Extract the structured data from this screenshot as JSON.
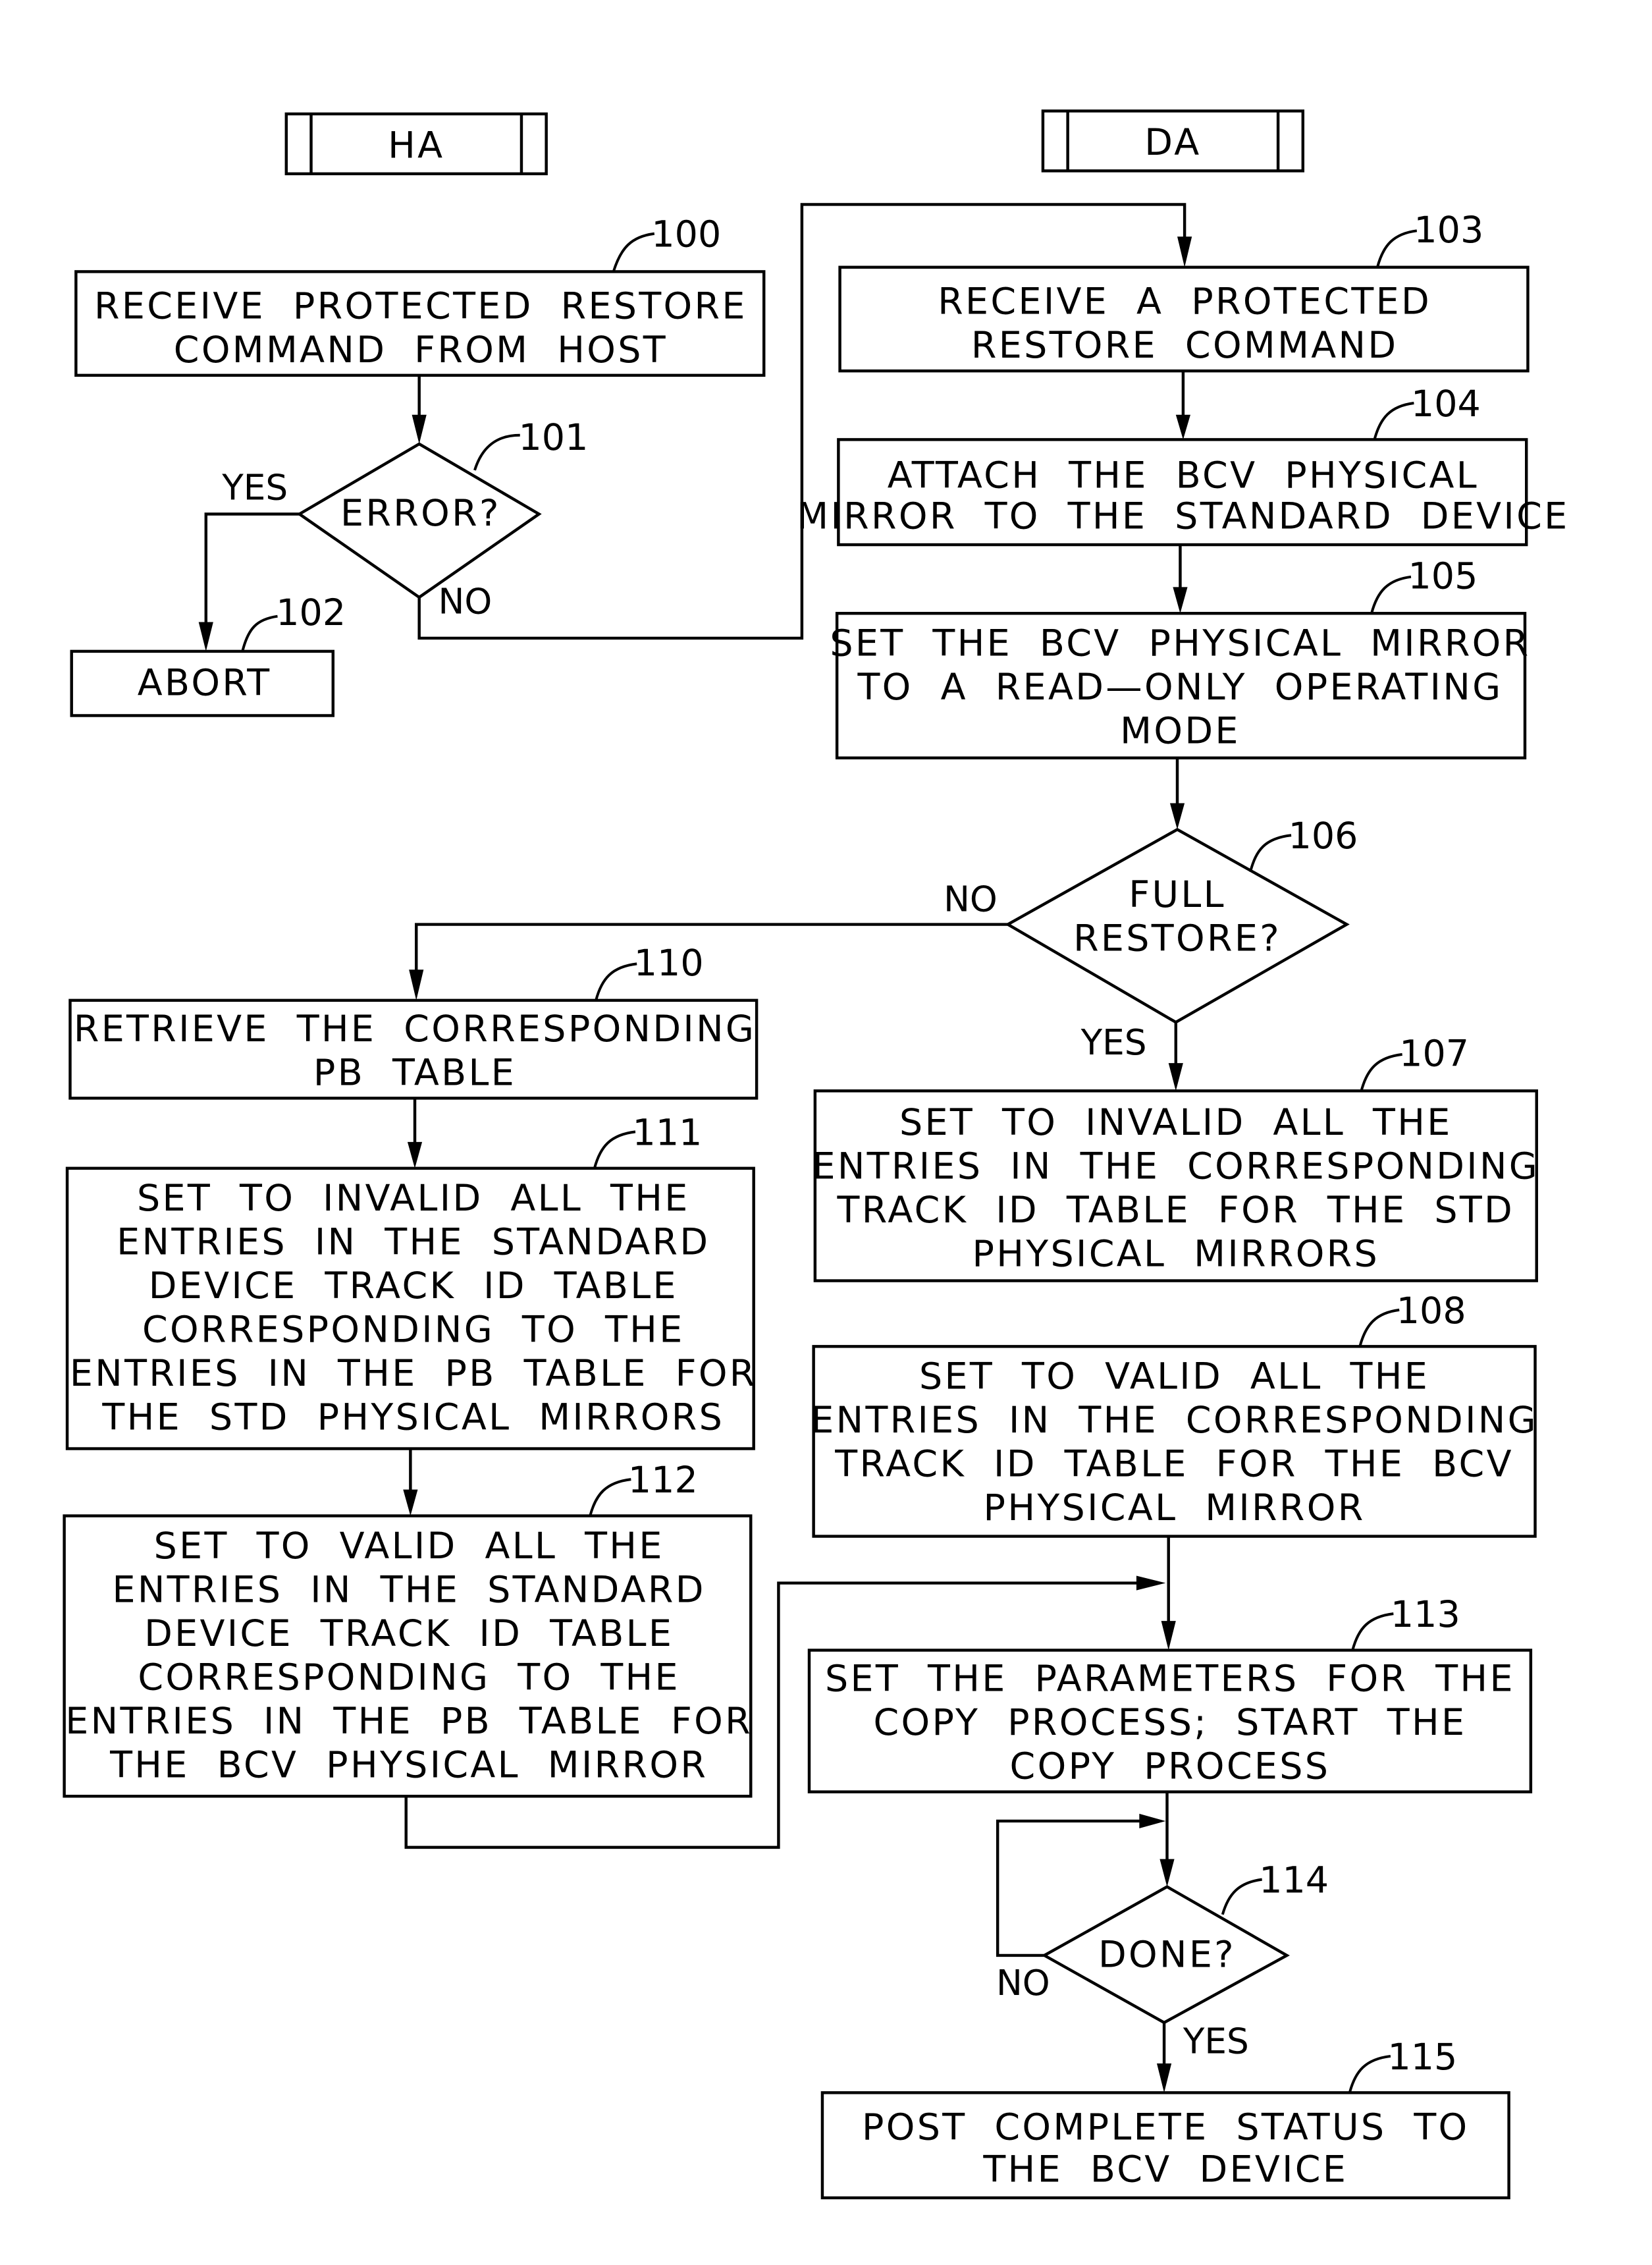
{
  "lanes": {
    "ha": "HA",
    "da": "DA"
  },
  "steps": {
    "s100": {
      "ref": "100",
      "lines": [
        "RECEIVE  PROTECTED  RESTORE",
        "COMMAND  FROM  HOST"
      ]
    },
    "s101": {
      "ref": "101",
      "lines": [
        "ERROR?"
      ],
      "yes": "YES",
      "no": "NO"
    },
    "s102": {
      "ref": "102",
      "lines": [
        "ABORT"
      ]
    },
    "s103": {
      "ref": "103",
      "lines": [
        "RECEIVE  A  PROTECTED",
        "RESTORE  COMMAND"
      ]
    },
    "s104": {
      "ref": "104",
      "lines": [
        "ATTACH  THE  BCV  PHYSICAL",
        "MIRROR  TO  THE  STANDARD  DEVICE"
      ]
    },
    "s105": {
      "ref": "105",
      "lines": [
        "SET  THE  BCV  PHYSICAL  MIRROR",
        "TO  A  READ—ONLY  OPERATING",
        "MODE"
      ]
    },
    "s106": {
      "ref": "106",
      "lines": [
        "FULL",
        "RESTORE?"
      ],
      "yes": "YES",
      "no": "NO"
    },
    "s107": {
      "ref": "107",
      "lines": [
        "SET  TO  INVALID  ALL  THE",
        "ENTRIES  IN  THE  CORRESPONDING",
        "TRACK  ID  TABLE  FOR  THE  STD",
        "PHYSICAL  MIRRORS"
      ]
    },
    "s108": {
      "ref": "108",
      "lines": [
        "SET  TO  VALID  ALL  THE",
        "ENTRIES  IN  THE  CORRESPONDING",
        "TRACK  ID  TABLE  FOR  THE  BCV",
        "PHYSICAL  MIRROR"
      ]
    },
    "s110": {
      "ref": "110",
      "lines": [
        "RETRIEVE  THE  CORRESPONDING",
        "PB  TABLE"
      ]
    },
    "s111": {
      "ref": "111",
      "lines": [
        "SET  TO  INVALID  ALL  THE",
        "ENTRIES  IN  THE  STANDARD",
        "DEVICE  TRACK  ID  TABLE",
        "CORRESPONDING  TO  THE",
        "ENTRIES  IN  THE  PB  TABLE  FOR",
        "THE  STD  PHYSICAL  MIRRORS"
      ]
    },
    "s112": {
      "ref": "112",
      "lines": [
        "SET  TO  VALID  ALL  THE",
        "ENTRIES  IN  THE  STANDARD",
        "DEVICE  TRACK  ID  TABLE",
        "CORRESPONDING  TO  THE",
        "ENTRIES  IN  THE  PB  TABLE  FOR",
        "THE  BCV  PHYSICAL  MIRROR"
      ]
    },
    "s113": {
      "ref": "113",
      "lines": [
        "SET  THE  PARAMETERS  FOR  THE",
        "COPY  PROCESS;  START  THE",
        "COPY  PROCESS"
      ]
    },
    "s114": {
      "ref": "114",
      "lines": [
        "DONE?"
      ],
      "yes": "YES",
      "no": "NO"
    },
    "s115": {
      "ref": "115",
      "lines": [
        "POST  COMPLETE  STATUS  TO",
        "THE  BCV  DEVICE"
      ]
    }
  }
}
